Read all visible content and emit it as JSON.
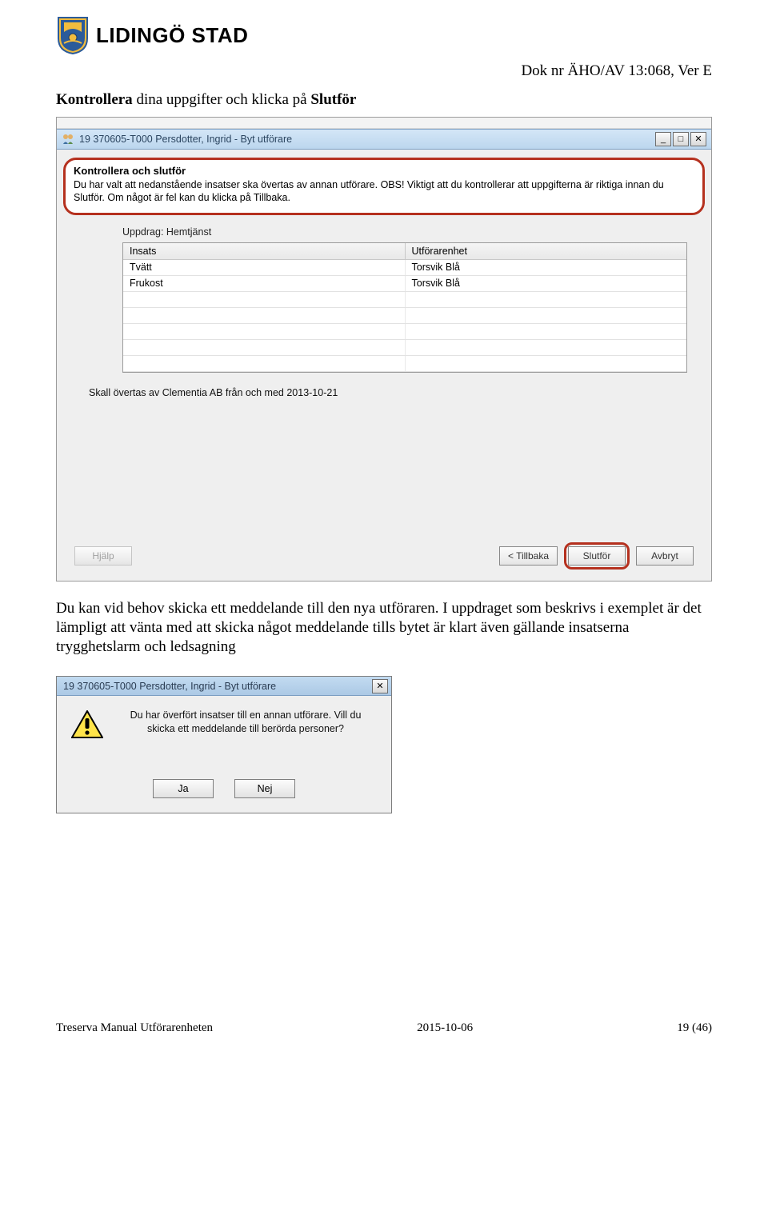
{
  "header": {
    "logo_text": "LIDINGÖ STAD"
  },
  "doc_nr": "Dok nr ÄHO/AV 13:068, Ver E",
  "instructions": {
    "line1_prefix": "Kontrollera",
    "line1_rest": " dina uppgifter och klicka på ",
    "line1_suffix": "Slutför"
  },
  "win1": {
    "title": "19 370605-T000 Persdotter, Ingrid - Byt utförare",
    "highlight_title": "Kontrollera och slutför",
    "highlight_body": "Du har valt att nedanstående insatser ska övertas av annan utförare. OBS! Viktigt att du kontrollerar att uppgifterna är riktiga innan du Slutför. Om något är fel kan du klicka på Tillbaka.",
    "uppdrag_label": "Uppdrag: Hemtjänst",
    "grid": {
      "col1": "Insats",
      "col2": "Utförarenhet",
      "rows": [
        {
          "c1": "Tvätt",
          "c2": "Torsvik Blå"
        },
        {
          "c1": "Frukost",
          "c2": "Torsvik Blå"
        },
        {
          "c1": "",
          "c2": ""
        },
        {
          "c1": "",
          "c2": ""
        },
        {
          "c1": "",
          "c2": ""
        },
        {
          "c1": "",
          "c2": ""
        },
        {
          "c1": "",
          "c2": ""
        }
      ]
    },
    "transfer_text": "Skall övertas av Clementia AB från och med 2013-10-21",
    "help_btn": "Hjälp",
    "back_btn": "< Tillbaka",
    "slutfor_btn": "Slutför",
    "avbryt_btn": "Avbryt"
  },
  "para": "Du kan vid behov skicka ett meddelande till den nya utföraren. I uppdraget som beskrivs i exemplet är det lämpligt att vänta med att skicka något meddelande tills bytet är klart även gällande insatserna trygghetslarm och ledsagning",
  "dlg2": {
    "title": "19 370605-T000 Persdotter, Ingrid - Byt utförare",
    "message": "Du har överfört insatser till en annan utförare. Vill du skicka ett meddelande till berörda personer?",
    "ja": "Ja",
    "nej": "Nej"
  },
  "footer": {
    "left": "Treserva Manual Utförarenheten",
    "center": "2015-10-06",
    "right": "19 (46)"
  }
}
